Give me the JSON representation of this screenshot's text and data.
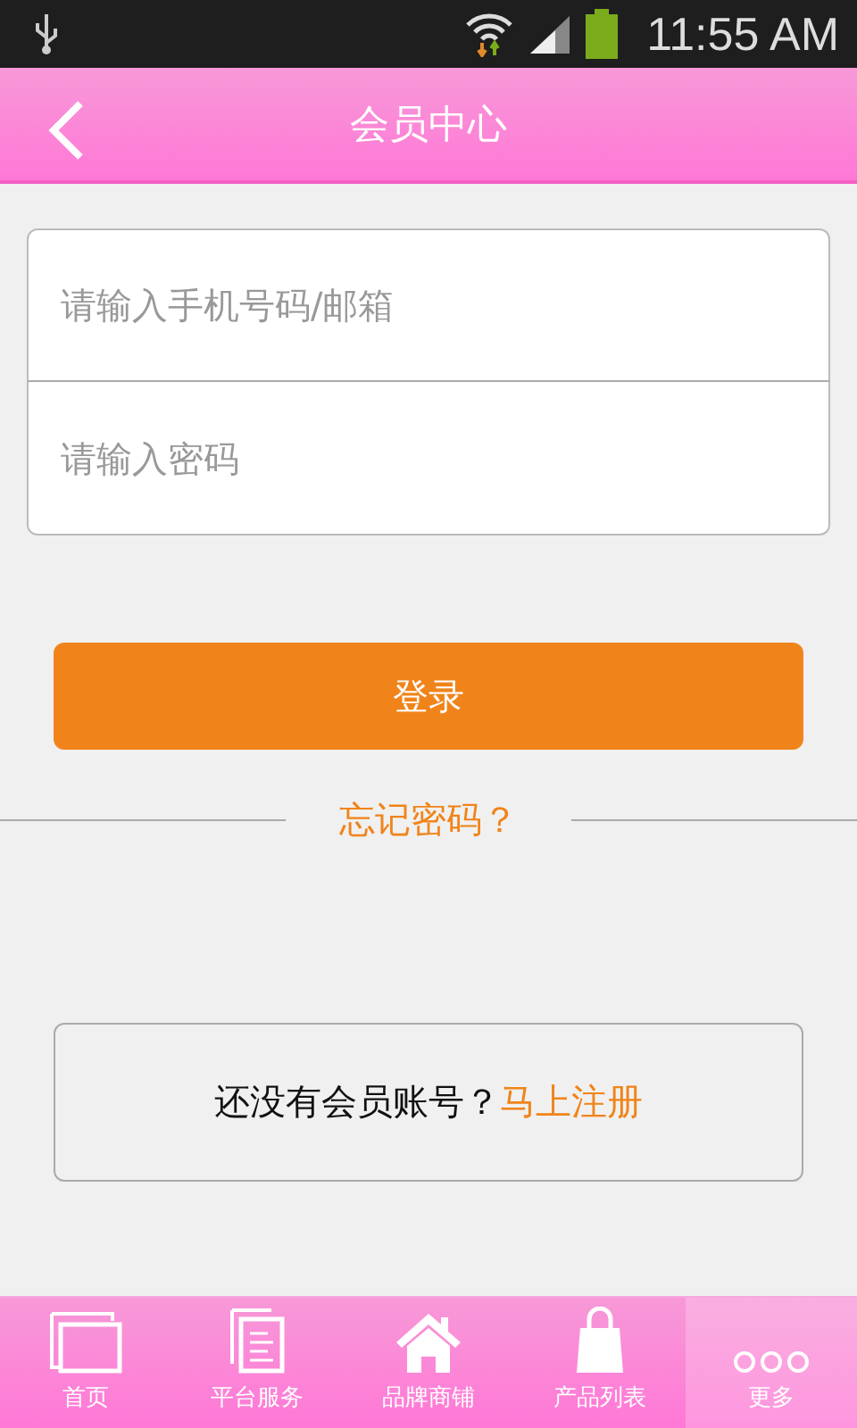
{
  "status_bar": {
    "time": "11:55 AM"
  },
  "header": {
    "title": "会员中心"
  },
  "form": {
    "phone": {
      "placeholder": "请输入手机号码/邮箱"
    },
    "password": {
      "placeholder": "请输入密码"
    }
  },
  "login_button": "登录",
  "forgot_link": "忘记密码？",
  "register": {
    "text": "还没有会员账号？",
    "link": "马上注册"
  },
  "bottom_nav": [
    {
      "kind": "home",
      "label": "首页",
      "selected": false
    },
    {
      "kind": "service",
      "label": "平台服务",
      "selected": false
    },
    {
      "kind": "brand",
      "label": "品牌商铺",
      "selected": false
    },
    {
      "kind": "products",
      "label": "产品列表",
      "selected": false
    },
    {
      "kind": "more",
      "label": "更多",
      "selected": true
    }
  ]
}
